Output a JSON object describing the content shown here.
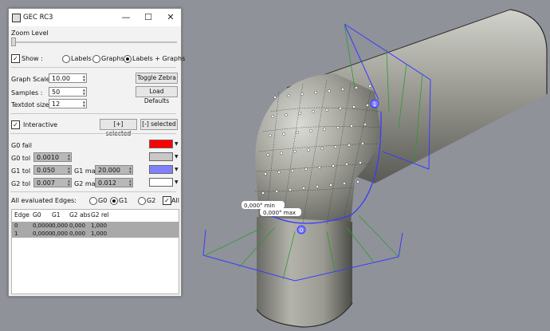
{
  "window": {
    "title": "GEC RC3",
    "minimize": "—",
    "maximize": "☐",
    "close": "✕"
  },
  "zoom": {
    "label": "Zoom Level",
    "level": 0
  },
  "show": {
    "label": "Show :",
    "checked": true,
    "options": [
      "Labels",
      "Graphs",
      "Labels + Graphs"
    ],
    "selected": "Labels + Graphs"
  },
  "settings": {
    "graph_scale_label": "Graph Scale :",
    "graph_scale": "10.00",
    "samples_label": "Samples :",
    "samples": "50",
    "textdot_label": "Textdot size:",
    "textdot": "12",
    "toggle_zebra": "Toggle Zebra",
    "load_defaults": "Load Defaults"
  },
  "interactive": {
    "label": "Interactive",
    "checked": true,
    "plus_selected": "[+] selected",
    "minus_selected": "[-] selected"
  },
  "tolerances": {
    "g0_fail_label": "G0 fail",
    "g0_tol_label": "G0 tol",
    "g0_tol": "0.0010",
    "g1_tol_label": "G1 tol",
    "g1_tol": "0.050",
    "g1_max_label": "G1 max",
    "g1_max": "20.000",
    "g2_tol_label": "G2 tol",
    "g2_tol": "0.007",
    "g2_max_label": "G2 max",
    "g2_max": "0.012",
    "colors": {
      "g0_fail": "#ff0000",
      "g0_tol": "#c8c8c8",
      "g1": "#8080ff",
      "g2": "#ffffff"
    }
  },
  "edges": {
    "label": "All evaluated Edges:",
    "options": [
      "G0",
      "G1",
      "G2"
    ],
    "selected": "G1",
    "all_label": "All",
    "all_checked": true
  },
  "table": {
    "headers": [
      "Edge",
      "G0",
      "G1",
      "G2 abs",
      "G2 rel"
    ],
    "rows": [
      [
        "0",
        "0,0000",
        "0,000",
        "0,000",
        "1,000"
      ],
      [
        "1",
        "0,0000",
        "0,000",
        "0,000",
        "1,000"
      ]
    ]
  },
  "viewport": {
    "annotation_min": "0,000° min",
    "annotation_max": "0,000° max",
    "marker_0": "0",
    "marker_1": "1",
    "colors": {
      "background": "#8f9299",
      "frame": "#3a3aff",
      "graph": "#2e9a2e"
    }
  }
}
